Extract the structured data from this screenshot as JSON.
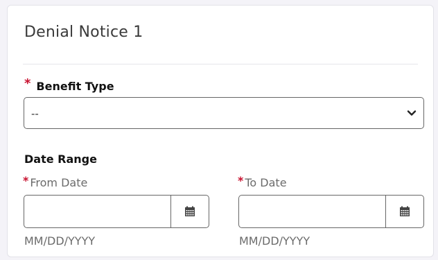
{
  "card": {
    "title": "Denial Notice 1"
  },
  "benefit_type": {
    "required_mark": "*",
    "label": "Benefit Type",
    "selected_value": "--"
  },
  "date_range": {
    "label": "Date Range",
    "from": {
      "required_mark": "*",
      "label": "From Date",
      "value": "",
      "hint": "MM/DD/YYYY"
    },
    "to": {
      "required_mark": "*",
      "label": "To Date",
      "value": "",
      "hint": "MM/DD/YYYY"
    }
  },
  "icons": {
    "select_arrow": "chevron-down-icon",
    "calendar": "calendar-icon"
  },
  "colors": {
    "required": "#c8102e",
    "border": "#666666",
    "muted_text": "#6b6b6b"
  }
}
